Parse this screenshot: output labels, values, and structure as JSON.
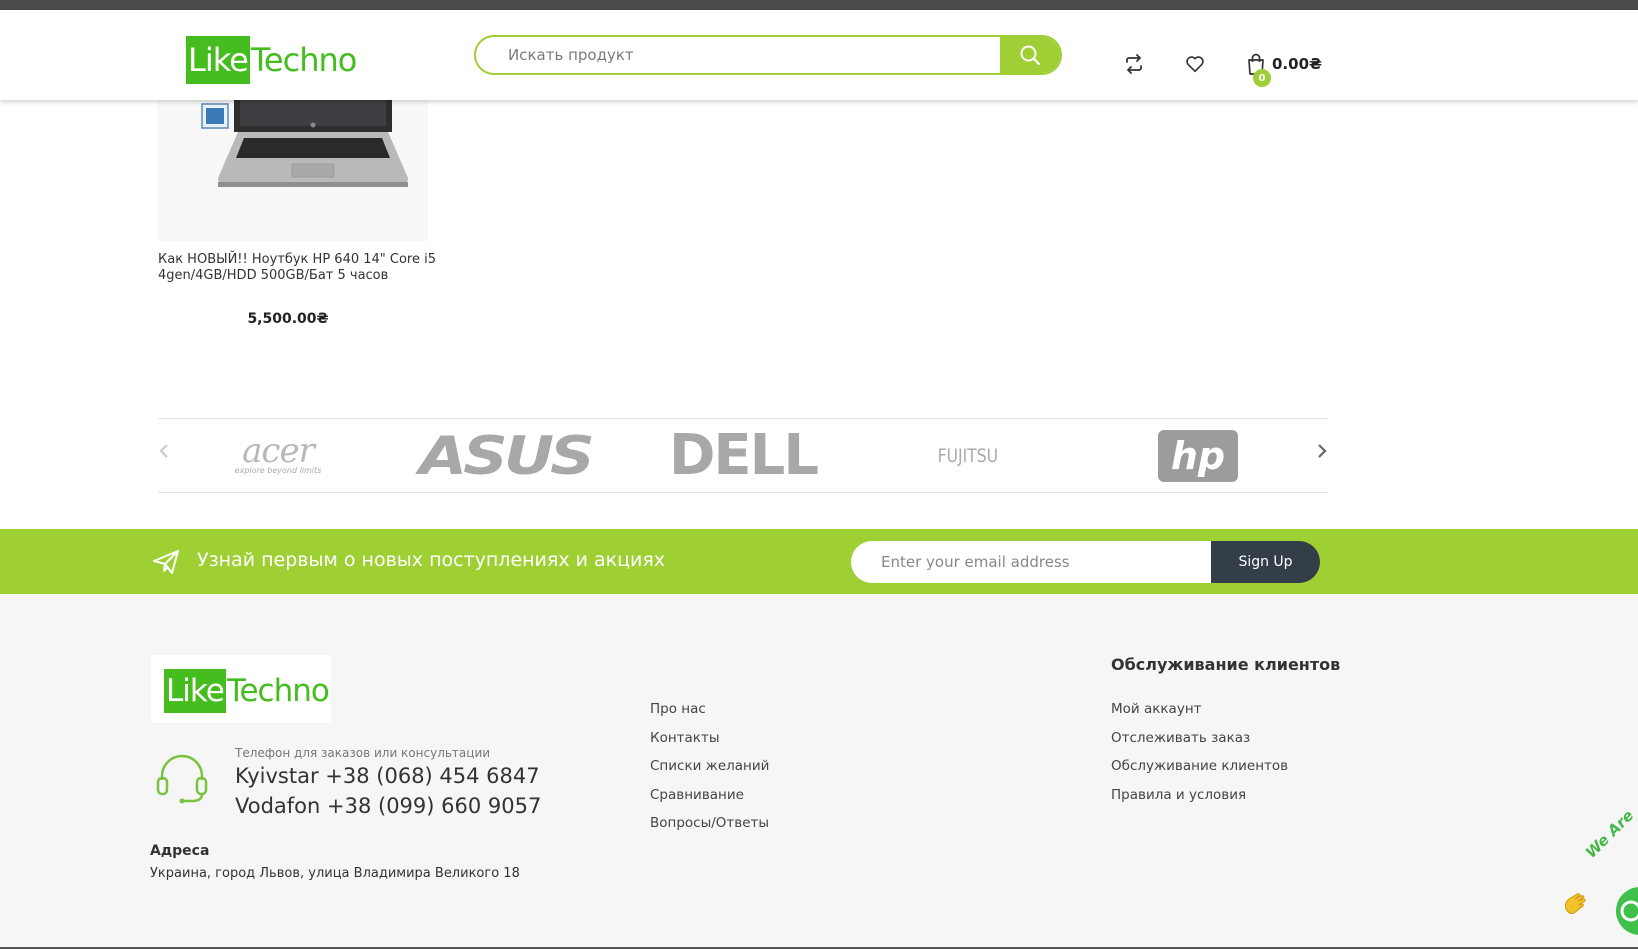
{
  "header": {
    "logo_mark": "Like",
    "logo_rest": "Techno",
    "search_placeholder": "Искать продукт",
    "cart_count": "0",
    "cart_total": "0.00₴"
  },
  "product": {
    "title": "Как НОВЫЙ!! Ноутбук HP 640 14\" Core i5 4gen/4GB/HDD 500GB/Бат 5 часов",
    "price": "5,500.00₴"
  },
  "brands": {
    "items": [
      "acer",
      "explore beyond limits",
      "ASUS",
      "DELL",
      "FUJITSU",
      "hp"
    ]
  },
  "newsletter": {
    "text": "Узнай первым о новых поступлениях и акциях",
    "email_placeholder": "Enter your email address",
    "button_label": "Sign Up"
  },
  "footer": {
    "logo_mark": "Like",
    "logo_rest": "Techno",
    "phone_label": "Телефон для заказов или консультации",
    "phone_1": "Kyivstar +38 (068) 454 6847",
    "phone_2": "Vodafon +38 (099) 660 9057",
    "address_title": "Адреса",
    "address_text": "Украина, город Львов, улица Владимира Великого 18",
    "links": [
      "Про нас",
      "Контакты",
      "Списки желаний",
      "Сравнивание",
      "Вопросы/Ответы"
    ],
    "service_title": "Обслуживание клиентов",
    "service_links": [
      "Мой аккаунт",
      "Отслеживать заказ",
      "Обслуживание клиентов",
      "Правила и условия"
    ]
  },
  "widget": {
    "text": "We Are"
  },
  "colors": {
    "accent": "#9fd033",
    "logo_green": "#46bd1e",
    "dark_button": "#333e48"
  }
}
